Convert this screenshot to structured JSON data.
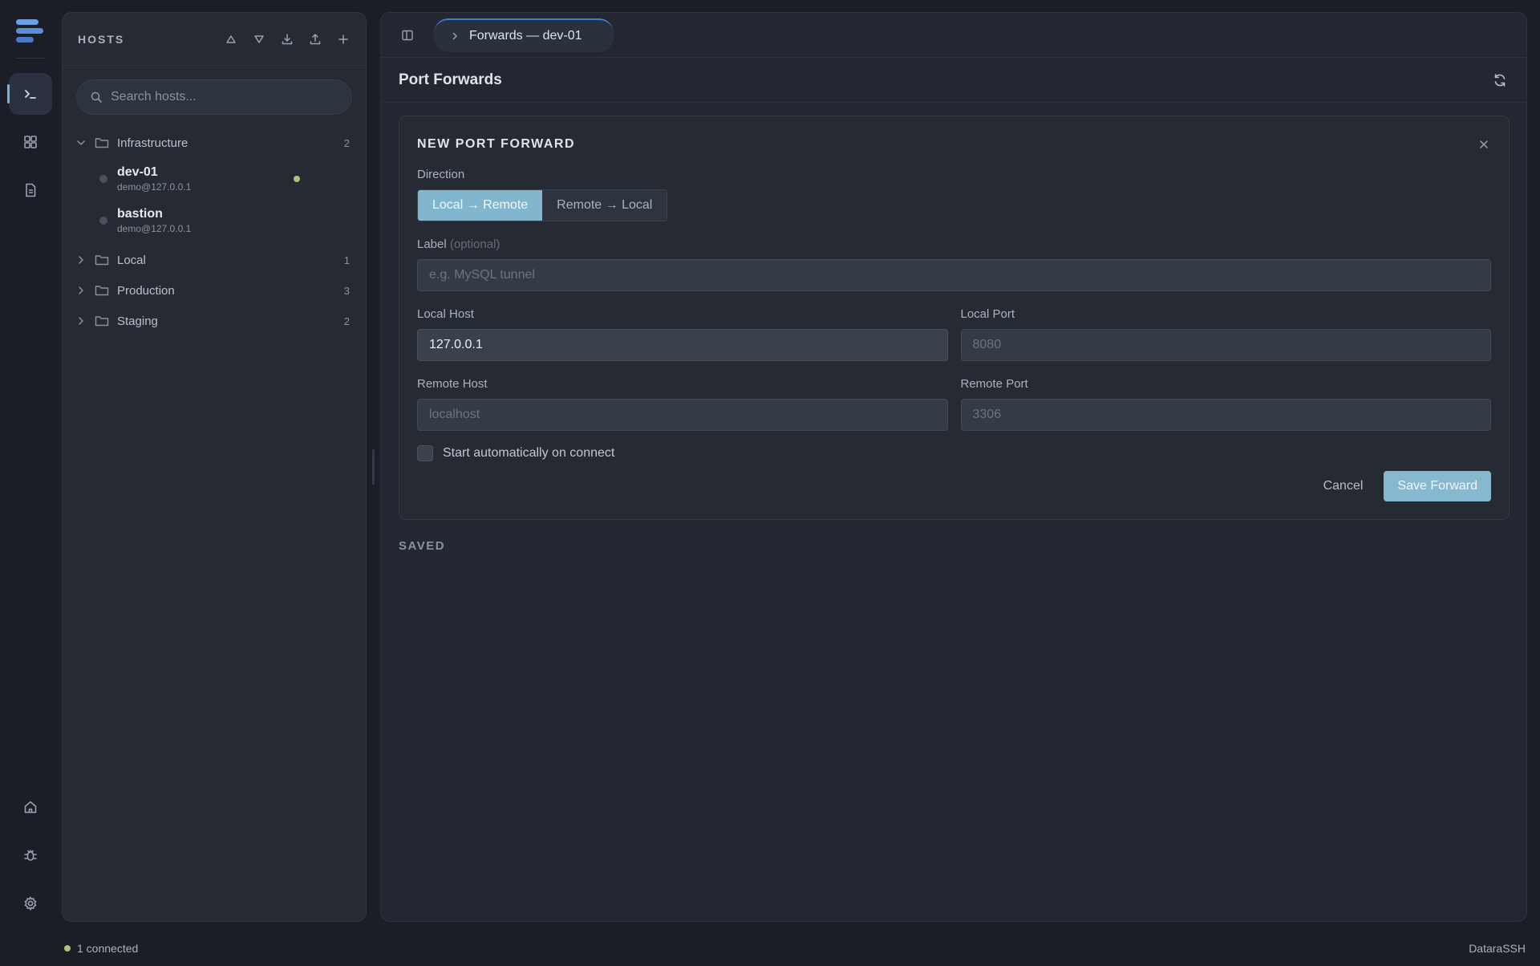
{
  "sidebar_hosts": {
    "title": "HOSTS",
    "search_placeholder": "Search hosts...",
    "groups": [
      {
        "name": "Infrastructure",
        "count": "2",
        "expanded": true,
        "hosts": [
          {
            "name": "dev-01",
            "address": "demo@127.0.0.1",
            "online": true
          },
          {
            "name": "bastion",
            "address": "demo@127.0.0.1",
            "online": false
          }
        ]
      },
      {
        "name": "Local",
        "count": "1",
        "expanded": false
      },
      {
        "name": "Production",
        "count": "3",
        "expanded": false
      },
      {
        "name": "Staging",
        "count": "2",
        "expanded": false
      }
    ]
  },
  "tab": {
    "label": "Forwards — dev-01"
  },
  "page": {
    "title": "Port Forwards"
  },
  "form": {
    "title": "NEW PORT FORWARD",
    "direction_label": "Direction",
    "direction_options": [
      "Local → Remote",
      "Remote → Local"
    ],
    "direction_selected": "Local → Remote",
    "label_label": "Label",
    "label_optional": "(optional)",
    "label_placeholder": "e.g. MySQL tunnel",
    "local_host_label": "Local Host",
    "local_host_value": "127.0.0.1",
    "local_port_label": "Local Port",
    "local_port_placeholder": "8080",
    "remote_host_label": "Remote Host",
    "remote_host_placeholder": "localhost",
    "remote_port_label": "Remote Port",
    "remote_port_placeholder": "3306",
    "auto_start_label": "Start automatically on connect",
    "auto_start_checked": false,
    "cancel_label": "Cancel",
    "save_label": "Save Forward"
  },
  "saved": {
    "title": "SAVED"
  },
  "status": {
    "connected_text": "1 connected",
    "brand": "DataraSSH"
  },
  "colors": {
    "accent": "#82b6cf",
    "online": "#a7c47a",
    "tab_accent": "#3f7fd6"
  }
}
